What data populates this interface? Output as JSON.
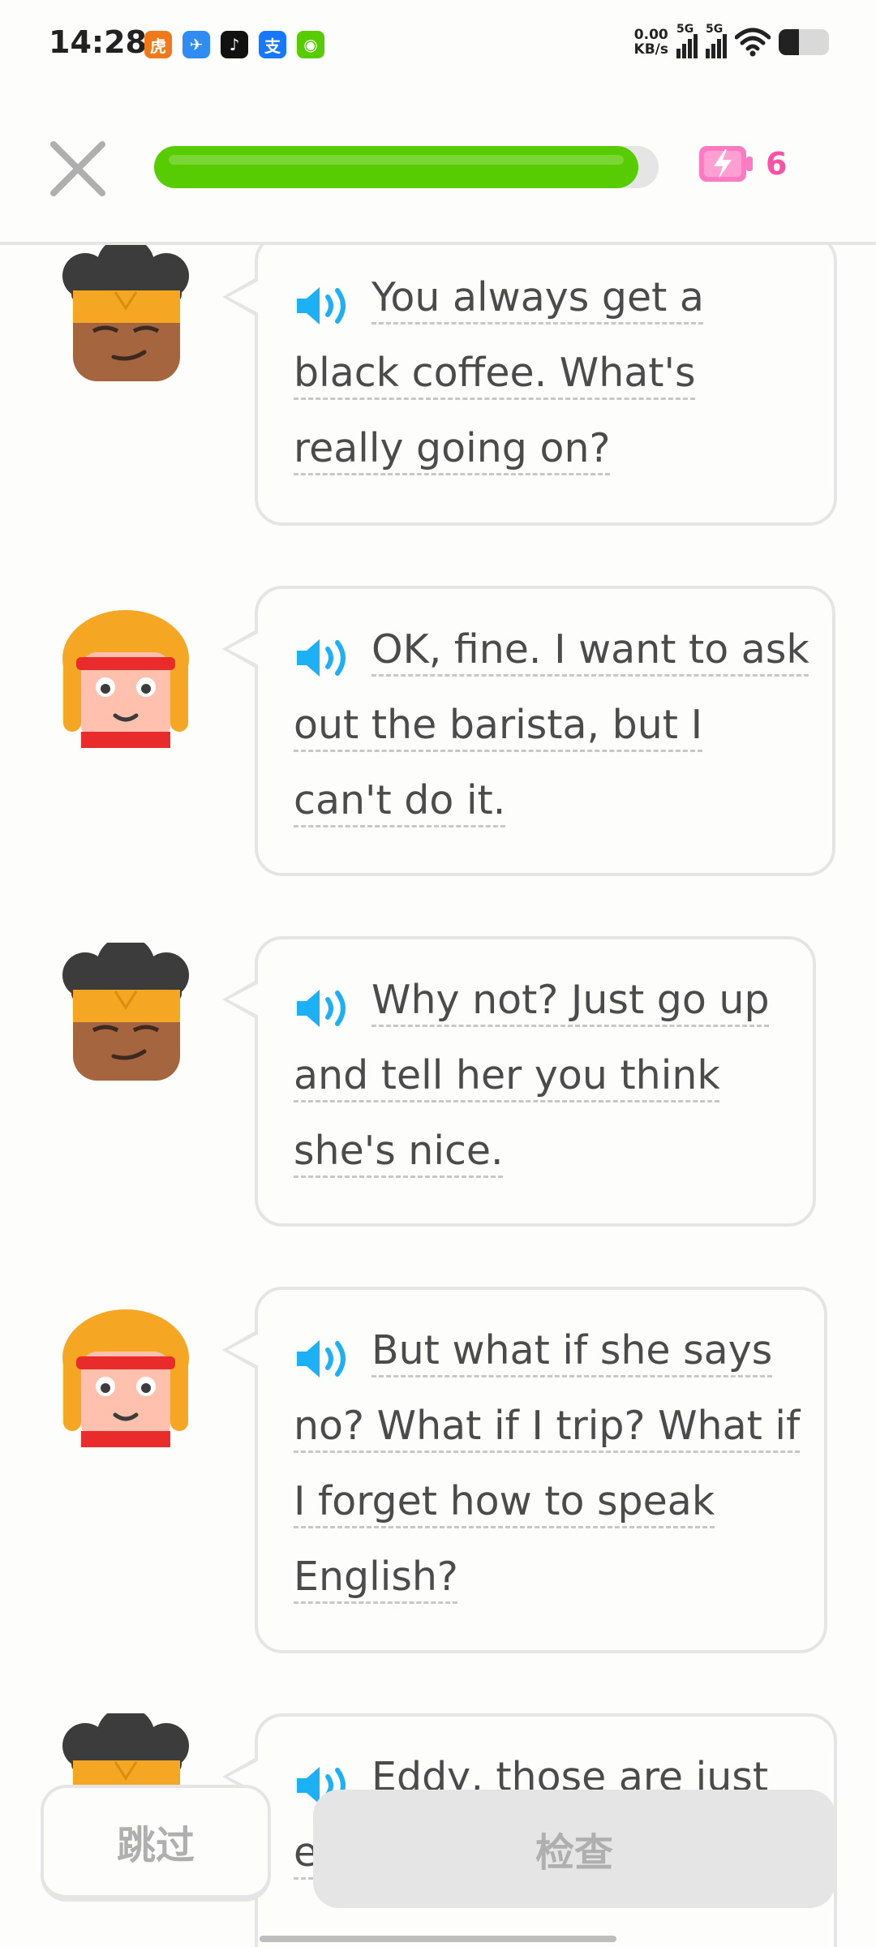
{
  "status_bar": {
    "time": "14:28",
    "apps": [
      {
        "icon": "tiger-app-icon",
        "color": "#f07a1a",
        "glyph": "虎"
      },
      {
        "icon": "paper-plane-app-icon",
        "color": "#2f8cf2",
        "glyph": "✈"
      },
      {
        "icon": "tiktok-app-icon",
        "color": "#111111",
        "glyph": "♪"
      },
      {
        "icon": "alipay-app-icon",
        "color": "#1677ff",
        "glyph": "支"
      },
      {
        "icon": "duolingo-app-icon",
        "color": "#58cc02",
        "glyph": "◉"
      }
    ],
    "net_speed_value": "0.00",
    "net_speed_unit": "KB/s",
    "signal1_label": "5G",
    "signal2_label": "5G",
    "battery_level": 0.4
  },
  "header": {
    "progress": 0.96,
    "energy_count": "6",
    "accent_color": "#58cc02",
    "energy_color": "#ff4fa6"
  },
  "messages": [
    {
      "speaker": "eddy-partner",
      "text": "You always get a black coffee. What's really going on?"
    },
    {
      "speaker": "eddy",
      "text": "OK, fine. I want to ask out the barista, but I can't do it."
    },
    {
      "speaker": "eddy-partner",
      "text": "Why not? Just go up and tell her you think she's nice."
    },
    {
      "speaker": "eddy",
      "text": "But what if she says no? What if I trip? What if I forget how to speak English?"
    },
    {
      "speaker": "eddy-partner",
      "text": "Eddy, those are just excuses. you practice."
    }
  ],
  "footer": {
    "skip_label": "跳过",
    "check_label": "检查"
  }
}
